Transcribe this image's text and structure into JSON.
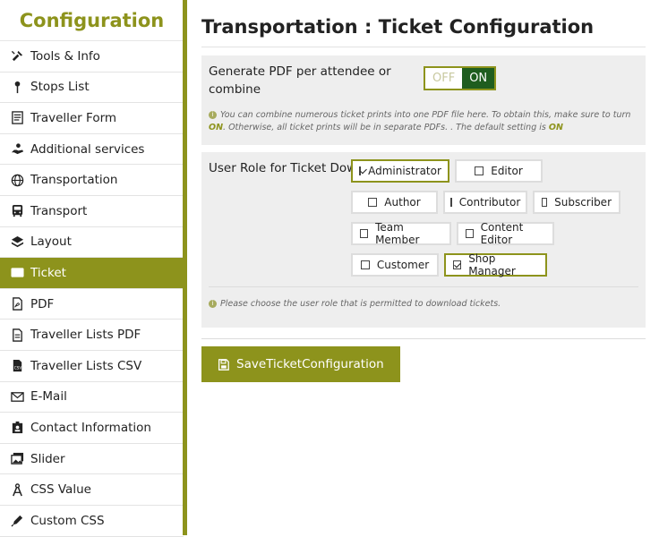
{
  "sidebar": {
    "title": "Configuration",
    "items": [
      {
        "label": "Tools & Info",
        "icon": "tools-icon"
      },
      {
        "label": "Stops List",
        "icon": "map-pin-icon"
      },
      {
        "label": "Traveller Form",
        "icon": "form-icon"
      },
      {
        "label": "Additional services",
        "icon": "hand-icon"
      },
      {
        "label": "Transportation",
        "icon": "globe-icon"
      },
      {
        "label": "Transport",
        "icon": "bus-icon"
      },
      {
        "label": "Layout",
        "icon": "layers-icon"
      },
      {
        "label": "Ticket",
        "icon": "ticket-icon"
      },
      {
        "label": "PDF",
        "icon": "pdf-icon"
      },
      {
        "label": "Traveller Lists PDF",
        "icon": "file-icon"
      },
      {
        "label": "Traveller Lists CSV",
        "icon": "csv-icon"
      },
      {
        "label": "E-Mail",
        "icon": "mail-icon"
      },
      {
        "label": "Contact Information",
        "icon": "contact-icon"
      },
      {
        "label": "Slider",
        "icon": "images-icon"
      },
      {
        "label": "CSS Value",
        "icon": "compass-icon"
      },
      {
        "label": "Custom CSS",
        "icon": "pen-icon"
      }
    ],
    "active_index": 7
  },
  "main": {
    "title": "Transportation : Ticket Configuration",
    "pdf_setting": {
      "label": "Generate PDF per attendee or combine",
      "toggle_off": "OFF",
      "toggle_on": "ON",
      "info_a": "You can combine numerous ticket prints into one PDF file here. To obtain this, make sure to turn",
      "info_on1": "ON",
      "info_b": ". Otherwise, all ticket prints will be in separate PDFs. . The default setting is",
      "info_on2": "ON"
    },
    "role_setting": {
      "label": "User Role for Ticket Download",
      "roles": [
        {
          "label": "Administrator",
          "checked": true
        },
        {
          "label": "Editor",
          "checked": false
        },
        {
          "label": "Author",
          "checked": false
        },
        {
          "label": "Contributor",
          "checked": false
        },
        {
          "label": "Subscriber",
          "checked": false
        },
        {
          "label": "Team Member",
          "checked": false
        },
        {
          "label": "Content Editor",
          "checked": false
        },
        {
          "label": "Customer",
          "checked": false
        },
        {
          "label": "Shop Manager",
          "checked": true
        }
      ],
      "info": "Please choose the user role that is permitted to download tickets."
    },
    "save_label": "SaveTicketConfiguration"
  },
  "colors": {
    "accent": "#8d931c",
    "toggle_on": "#1f5d1f",
    "panel": "#eeeeee"
  }
}
